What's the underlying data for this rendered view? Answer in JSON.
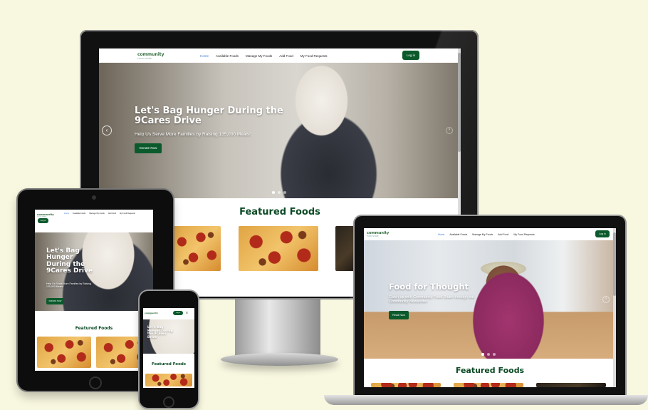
{
  "site": {
    "logo": "community",
    "logo_sub": "FOOD SHARE",
    "nav": [
      "Home",
      "Available Foods",
      "Manage My Foods",
      "Add Food",
      "My Food Requests"
    ],
    "login": "Log in",
    "featured": "Featured Foods"
  },
  "hero_winter": {
    "title": "Let's Bag Hunger During the 9Cares Drive",
    "subtitle": "Help Us Serve More Families by Raising 135,000 Meals!",
    "cta": "Donate Now"
  },
  "hero_food": {
    "title": "Food for Thought",
    "subtitle": "Catch up with Community Food Share through our Community Newsletter",
    "cta": "Read Now"
  },
  "tablet_hero": {
    "title": "Let's Bag Hunger During the 9Cares Drive",
    "subtitle": "Help Us Serve More Families by Raising 135,000 Meals!",
    "cta": "DONATE NOW"
  },
  "colors": {
    "brand_green": "#0b5a2c",
    "heading_green": "#0b4a24",
    "page_bg": "#f8f7df",
    "active_link": "#3a7bd5"
  }
}
